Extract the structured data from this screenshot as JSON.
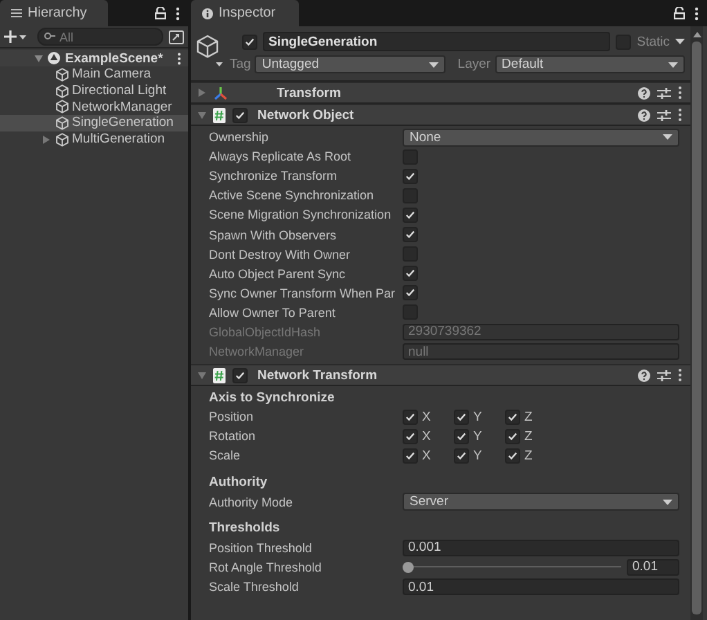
{
  "hierarchy": {
    "title": "Hierarchy",
    "search": {
      "placeholder": "All"
    },
    "scene": {
      "name": "ExampleScene*",
      "expanded": true,
      "items": [
        {
          "name": "Main Camera",
          "selected": false,
          "expandable": false
        },
        {
          "name": "Directional Light",
          "selected": false,
          "expandable": false
        },
        {
          "name": "NetworkManager",
          "selected": false,
          "expandable": false
        },
        {
          "name": "SingleGeneration",
          "selected": true,
          "expandable": false
        },
        {
          "name": "MultiGeneration",
          "selected": false,
          "expandable": true
        }
      ]
    }
  },
  "inspector": {
    "title": "Inspector",
    "object": {
      "active": true,
      "name": "SingleGeneration",
      "static": false,
      "static_label": "Static",
      "tag_label": "Tag",
      "tag": "Untagged",
      "layer_label": "Layer",
      "layer": "Default"
    },
    "components": [
      {
        "title": "Transform",
        "kind": "transform",
        "expanded": false
      },
      {
        "title": "Network Object",
        "kind": "script",
        "enabled": true,
        "expanded": true,
        "rows": [
          {
            "kind": "dropdown",
            "label": "Ownership",
            "value": "None"
          },
          {
            "kind": "checkbox",
            "label": "Always Replicate As Root",
            "checked": false
          },
          {
            "kind": "checkbox",
            "label": "Synchronize Transform",
            "checked": true
          },
          {
            "kind": "checkbox",
            "label": "Active Scene Synchronization",
            "checked": false
          },
          {
            "kind": "checkbox",
            "label": "Scene Migration Synchronization",
            "checked": true
          },
          {
            "kind": "checkbox",
            "label": "Spawn With Observers",
            "checked": true
          },
          {
            "kind": "checkbox",
            "label": "Dont Destroy With Owner",
            "checked": false
          },
          {
            "kind": "checkbox",
            "label": "Auto Object Parent Sync",
            "checked": true
          },
          {
            "kind": "checkbox",
            "label": "Sync Owner Transform When Par",
            "checked": true
          },
          {
            "kind": "checkbox",
            "label": "Allow Owner To Parent",
            "checked": false
          },
          {
            "kind": "readonly",
            "label": "GlobalObjectIdHash",
            "value": "2930739362"
          },
          {
            "kind": "readonly",
            "label": "NetworkManager",
            "value": "null"
          }
        ]
      },
      {
        "title": "Network Transform",
        "kind": "script",
        "enabled": true,
        "expanded": true,
        "rows": [
          {
            "kind": "heading",
            "label": "Axis to Synchronize"
          },
          {
            "kind": "axes",
            "label": "Position",
            "axes": [
              {
                "name": "X",
                "checked": true
              },
              {
                "name": "Y",
                "checked": true
              },
              {
                "name": "Z",
                "checked": true
              }
            ]
          },
          {
            "kind": "axes",
            "label": "Rotation",
            "axes": [
              {
                "name": "X",
                "checked": true
              },
              {
                "name": "Y",
                "checked": true
              },
              {
                "name": "Z",
                "checked": true
              }
            ]
          },
          {
            "kind": "axes",
            "label": "Scale",
            "axes": [
              {
                "name": "X",
                "checked": true
              },
              {
                "name": "Y",
                "checked": true
              },
              {
                "name": "Z",
                "checked": true
              }
            ]
          },
          {
            "kind": "heading",
            "label": "Authority"
          },
          {
            "kind": "dropdown",
            "label": "Authority Mode",
            "value": "Server"
          },
          {
            "kind": "heading",
            "label": "Thresholds"
          },
          {
            "kind": "field",
            "label": "Position Threshold",
            "value": "0.001"
          },
          {
            "kind": "slider",
            "label": "Rot Angle Threshold",
            "value": "0.01",
            "level": 0
          },
          {
            "kind": "field",
            "label": "Scale Threshold",
            "value": "0.01"
          }
        ]
      }
    ]
  }
}
